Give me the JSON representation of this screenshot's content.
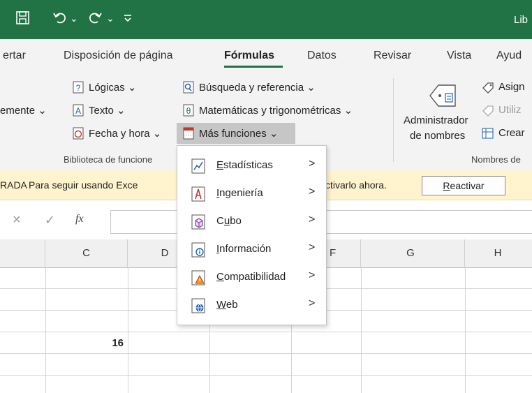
{
  "titlebar": {
    "save_icon": "save-icon",
    "undo_icon": "undo-icon",
    "redo_icon": "redo-icon",
    "customize_icon": "customize-qat-icon",
    "chev": "⌄",
    "title_partial": "Lib"
  },
  "tabs": [
    {
      "label": "ertar"
    },
    {
      "label": "Disposición de página"
    },
    {
      "label": "Fórmulas"
    },
    {
      "label": "Datos"
    },
    {
      "label": "Revisar"
    },
    {
      "label": "Vista"
    },
    {
      "label": "Ayud"
    }
  ],
  "ribbon": {
    "recently_used": "emente ⌄",
    "logicas": "Lógicas ⌄",
    "texto": "Texto ⌄",
    "fecha": "Fecha y hora ⌄",
    "busqueda": "Búsqueda y referencia ⌄",
    "matematicas": "Matemáticas y trigonométricas ⌄",
    "mas_funciones": "Más funciones ⌄",
    "group_library": "Biblioteca de funcione",
    "admin_nombres_1": "Administrador",
    "admin_nombres_2": "de nombres",
    "asignar": "Asign",
    "utilizar": "Utiliz",
    "crear": "Crear",
    "group_names": "Nombres de"
  },
  "notification": {
    "prefix": "RADA",
    "message_left": "Para seguir usando Exce",
    "message_right": "ctivarlo ahora.",
    "button": "Reactivar"
  },
  "formula_bar": {
    "cancel": "×",
    "enter": "✓",
    "fx": "fx"
  },
  "columns": [
    "C",
    "D",
    "F",
    "G",
    "H"
  ],
  "cells": {
    "c_value": "16"
  },
  "menu": {
    "items": [
      {
        "label": "Estadísticas",
        "accel": "E",
        "rest": "stadísticas",
        "icon": "statistics-icon"
      },
      {
        "label": "Ingeniería",
        "accel": "I",
        "rest": "ngeniería",
        "icon": "engineering-icon"
      },
      {
        "label": "Cubo",
        "accel": "u",
        "pre": "C",
        "rest": "bo",
        "icon": "cube-icon"
      },
      {
        "label": "Información",
        "accel": "I",
        "rest": "nformación",
        "icon": "information-icon"
      },
      {
        "label": "Compatibilidad",
        "accel": "C",
        "rest": "ompatibilidad",
        "icon": "compatibility-icon"
      },
      {
        "label": "Web",
        "accel": "W",
        "rest": "eb",
        "icon": "web-icon"
      }
    ],
    "arrow": ">"
  }
}
